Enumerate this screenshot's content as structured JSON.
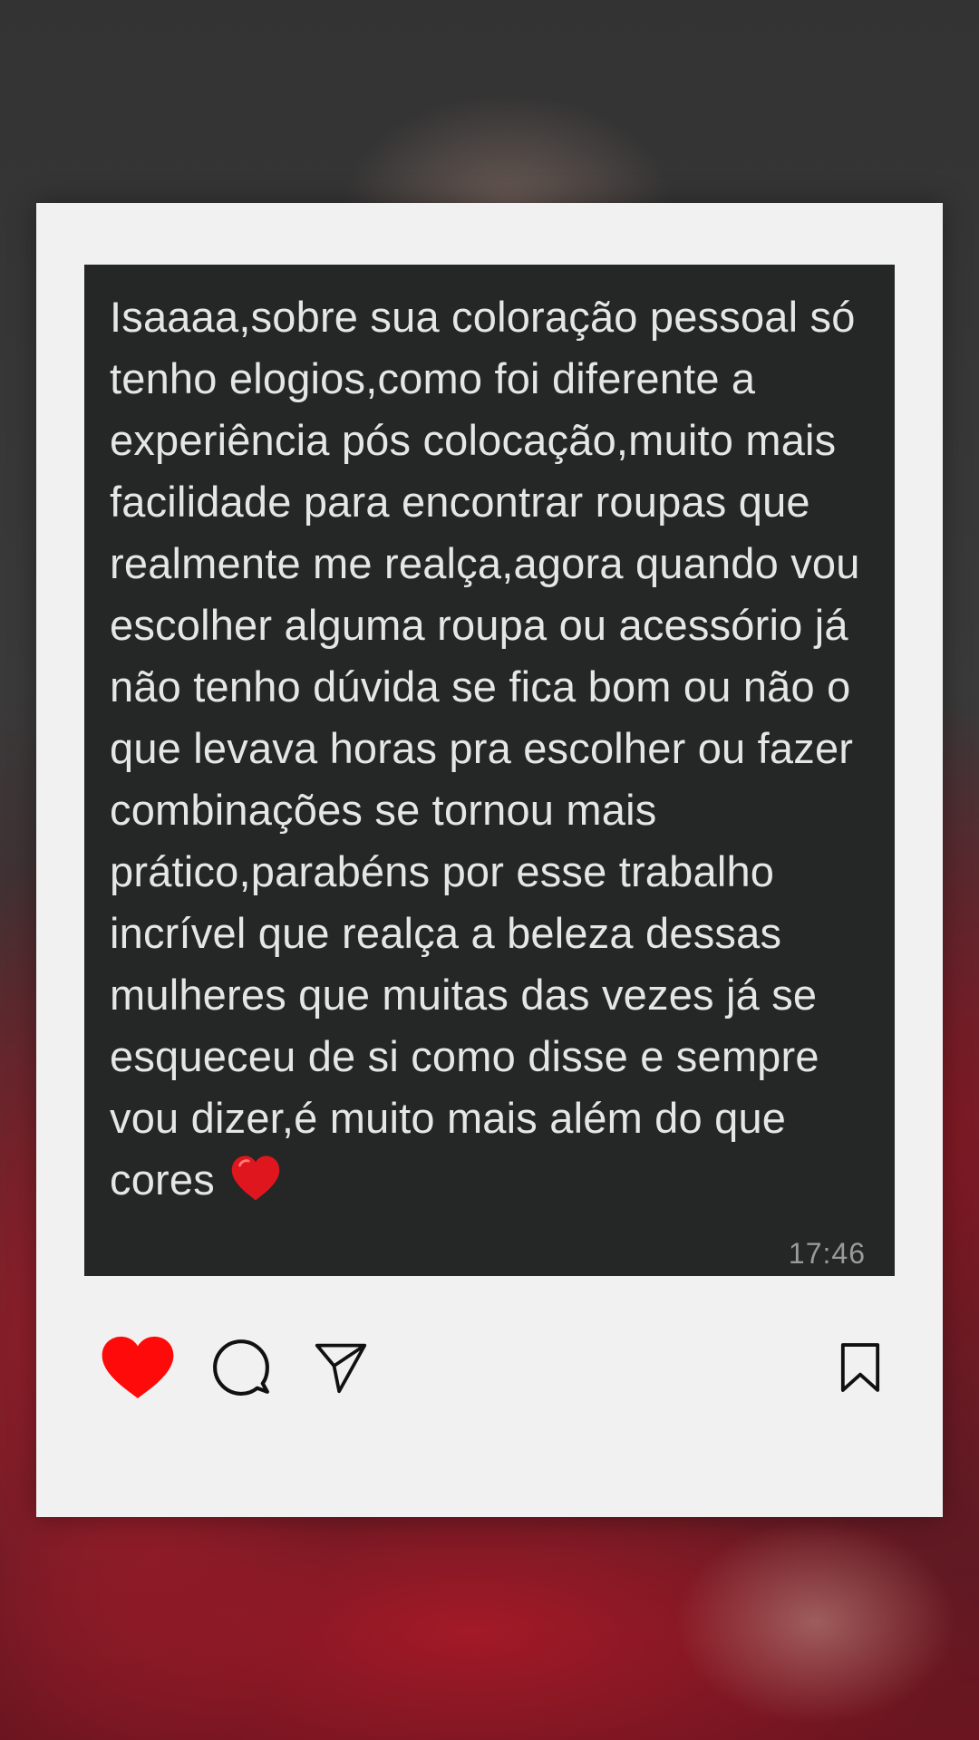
{
  "message": {
    "text": "Isaaaa,sobre sua coloração pessoal só tenho elogios,como foi diferente a experiência pós colocação,muito mais facilidade para encontrar roupas que realmente me realça,agora quando vou escolher alguma roupa ou acessório já não tenho dúvida se fica bom ou não o que levava horas pra escolher ou fazer combinações se tornou mais prático,parabéns por esse trabalho incrível que realça a beleza dessas mulheres que muitas das vezes já se esqueceu de si como disse e sempre vou dizer,é muito mais além do que cores",
    "emoji": "red-heart-emoji",
    "timestamp": "17:46"
  },
  "actions": {
    "like_icon": "heart-filled-icon",
    "comment_icon": "comment-bubble-icon",
    "share_icon": "paper-plane-icon",
    "save_icon": "bookmark-icon"
  },
  "colors": {
    "card_background": "#f1f1f1",
    "message_background": "#252626",
    "message_text": "#e6e6e6",
    "timestamp_text": "#9a9a9a",
    "like_red": "#ff0a0a",
    "icon_stroke": "#111111"
  }
}
